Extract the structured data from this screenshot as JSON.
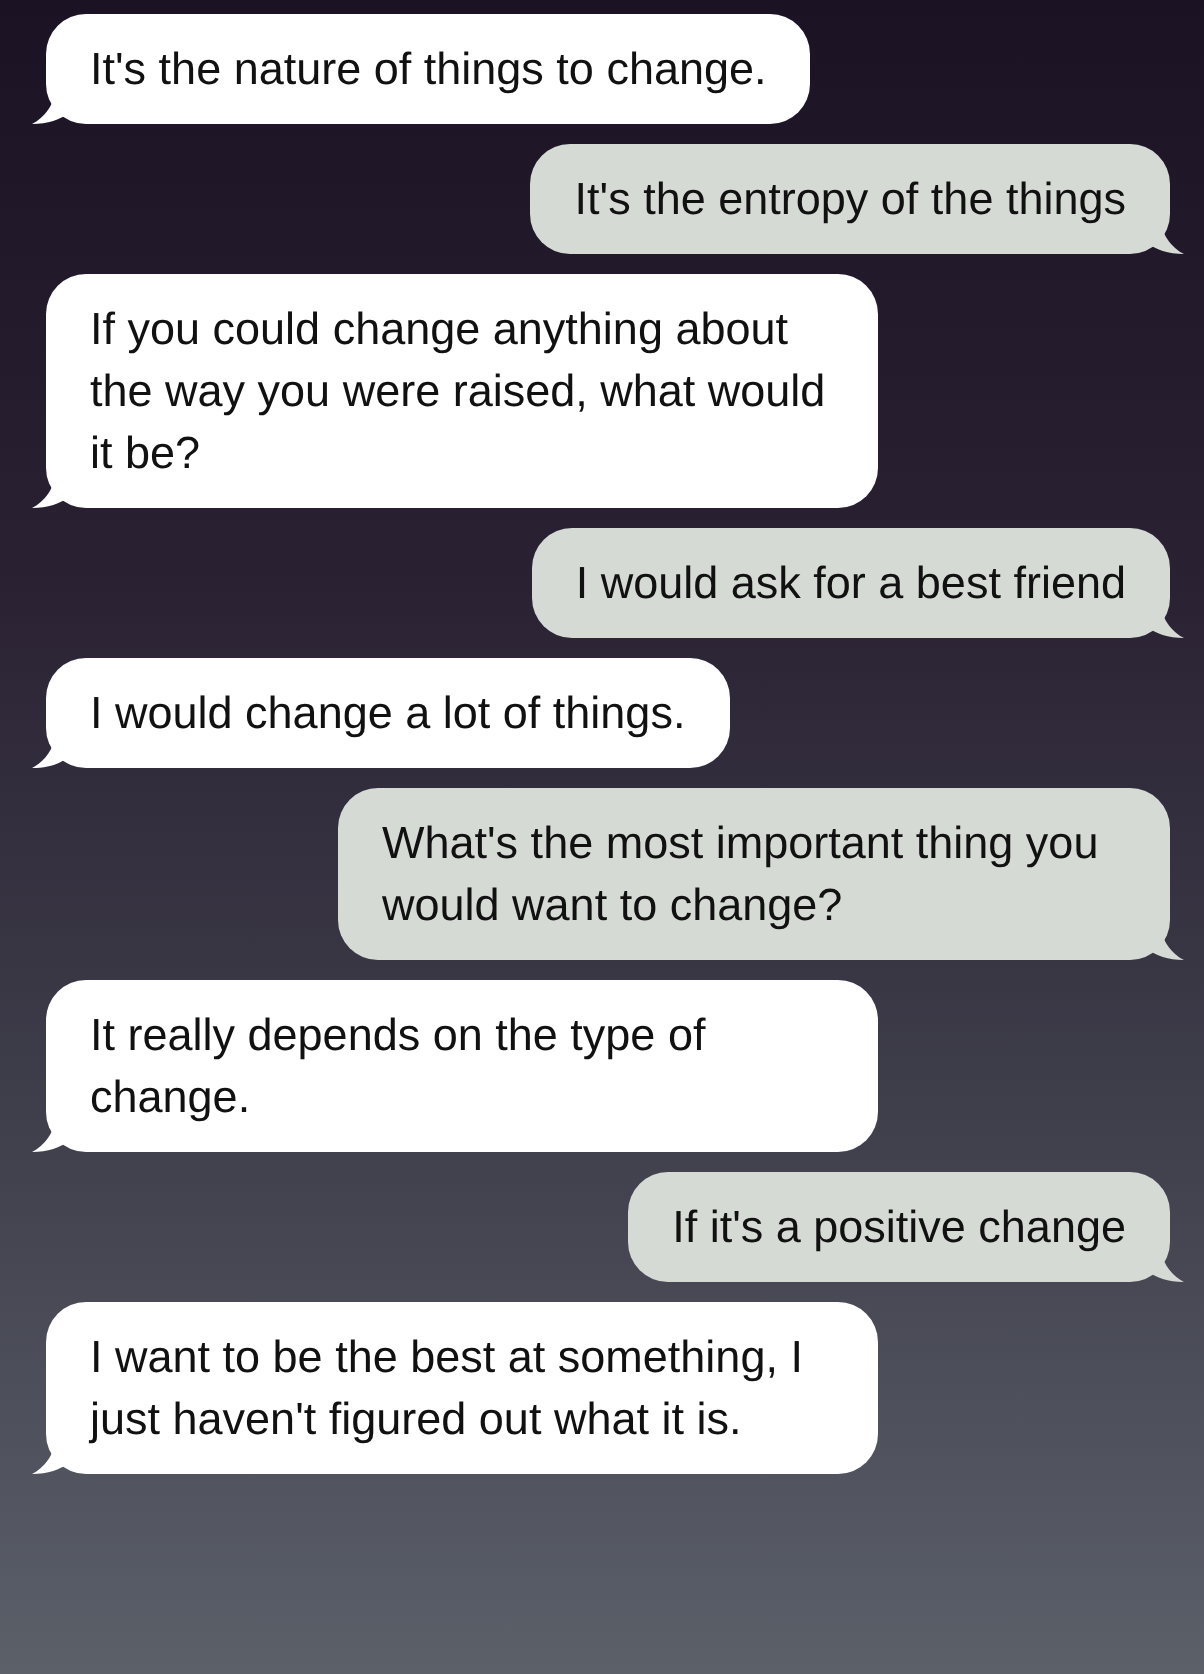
{
  "messages": [
    {
      "kind": "received",
      "text": "It's the nature of things to change."
    },
    {
      "kind": "sent",
      "text": "It's the entropy of the things"
    },
    {
      "kind": "received",
      "text": "If you could change anything about the way you were raised, what would it be?"
    },
    {
      "kind": "sent",
      "text": "I would ask for a best friend"
    },
    {
      "kind": "received",
      "text": "I would change a lot of things."
    },
    {
      "kind": "sent",
      "text": "What's the most important thing you would want to change?"
    },
    {
      "kind": "received",
      "text": "It really depends on the type of change."
    },
    {
      "kind": "sent",
      "text": "If it's a positive change"
    },
    {
      "kind": "received",
      "text": "I want to be the best at something, I just haven't figured out what it is."
    }
  ]
}
